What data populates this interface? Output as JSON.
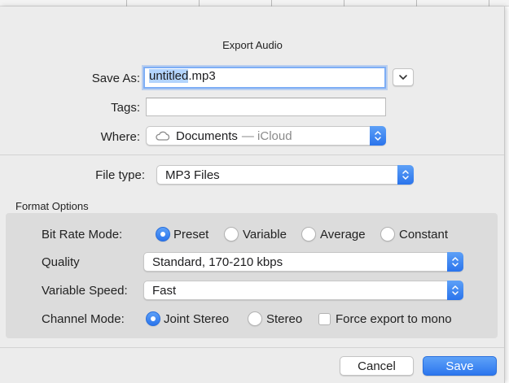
{
  "dialog": {
    "title": "Export Audio"
  },
  "save_as": {
    "label": "Save As:",
    "filename_selected": "untitled",
    "filename_ext": ".mp3",
    "expand_icon": "chevron-down-icon"
  },
  "tags": {
    "label": "Tags:",
    "value": ""
  },
  "where": {
    "label": "Where:",
    "icon": "cloud-icon",
    "location": "Documents",
    "location_suffix": "— iCloud"
  },
  "file_type": {
    "label": "File type:",
    "value": "MP3 Files"
  },
  "format_options": {
    "heading": "Format Options",
    "bit_rate_mode": {
      "label": "Bit Rate Mode:",
      "options": [
        "Preset",
        "Variable",
        "Average",
        "Constant"
      ],
      "selected": "Preset"
    },
    "quality": {
      "label": "Quality",
      "value": "Standard, 170-210 kbps"
    },
    "variable_speed": {
      "label": "Variable Speed:",
      "value": "Fast"
    },
    "channel_mode": {
      "label": "Channel Mode:",
      "options": [
        "Joint Stereo",
        "Stereo"
      ],
      "selected": "Joint Stereo",
      "force_mono_label": "Force export to mono",
      "force_mono_checked": false
    }
  },
  "buttons": {
    "cancel": "Cancel",
    "save": "Save"
  },
  "colors": {
    "accent": "#2a74ec",
    "sheet_bg": "#ececec",
    "panel_bg": "#dcdcdc"
  }
}
